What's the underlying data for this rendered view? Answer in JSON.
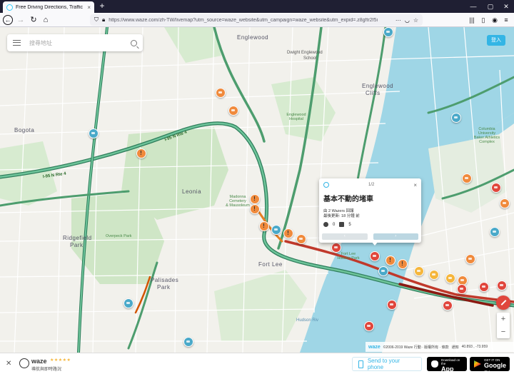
{
  "browser": {
    "tab_title": "Free Driving Directions, Traffic",
    "tab_close": "×",
    "new_tab": "+",
    "url": "https://www.waze.com/zh-TW/livemap?utm_source=waze_website&utm_campaign=waze_website&utm_expid=.z8gftr2f5i",
    "controls": {
      "minimize": "—",
      "maximize": "▢",
      "close": "✕"
    }
  },
  "map": {
    "search_placeholder": "搜尋地址",
    "login_label": "登入",
    "labels": {
      "englewood": "Englewood",
      "dwight_englewood": "Dwight Englewood",
      "school": "School",
      "englewood_cliffs": "Englewood",
      "cliffs": "Cliffs",
      "bogota": "Bogota",
      "leonia": "Leonia",
      "ridgefield": "Ridgefield",
      "park": "Park",
      "fort_lee": "Fort Lee",
      "palisades": "Palisades",
      "palisades_park": "Park",
      "hudson_river": "Hudson Riv",
      "madonna_cemetery": "Madonna\nCemetery\n& Mausoleum",
      "overpeck_park": "Overpeck Park",
      "englewood_hospital": "Englewood\nHospital",
      "rte_4": "I-95 N Rte 4",
      "rte_4_w": "I-95 N Rte 4",
      "columbia": "Columbia\nUniversity\nBaker Athletics\nComplex",
      "hudson_river_label": "Hudson Riv",
      "fort_lee_hist": "Fort Lee\nHistoric Park"
    },
    "popup": {
      "pager_text": "1/2",
      "close": "×",
      "title": "基本不動的堵車",
      "reporter": "由 2 Wazers 回報",
      "last_update": "最後更新: 18 分鐘 前",
      "comments": "0",
      "thanks": "5",
      "prev": "‹",
      "next": "›"
    },
    "zoom_in": "+",
    "zoom_out": "−",
    "footer": {
      "brand": "waze",
      "copyright": "©2006-2019 Waze 行動 · 版權所有 · 條款",
      "help": "通知",
      "coords": "40.893 , -73.959"
    }
  },
  "banner": {
    "close": "✕",
    "app_name": "waze",
    "stars": "★★★★★",
    "tagline": "導航與即時路況",
    "send_label": "Send to your phone",
    "app_store_small": "Download on the",
    "app_store_big": "App Store",
    "google_play_small": "GET IT ON",
    "google_play_big": "Google Play"
  }
}
